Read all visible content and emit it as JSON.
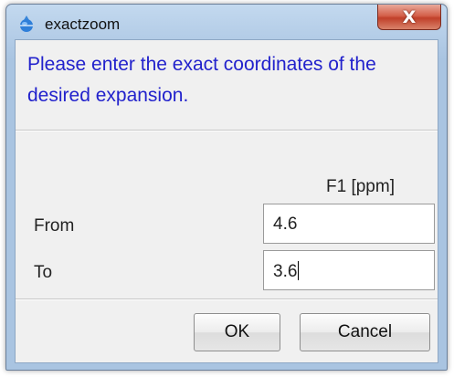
{
  "window": {
    "title": "exactzoom",
    "close_label": "X"
  },
  "message": "Please enter the exact coordinates of the desired expansion.",
  "column_header": "F1 [ppm]",
  "fields": {
    "from": {
      "label": "From",
      "value": "4.6"
    },
    "to": {
      "label": "To",
      "value": "3.6"
    }
  },
  "buttons": {
    "ok": "OK",
    "cancel": "Cancel"
  },
  "colors": {
    "message_text": "#2222cc",
    "title_bar": "#b2cbe6",
    "close_button": "#c0402a"
  }
}
